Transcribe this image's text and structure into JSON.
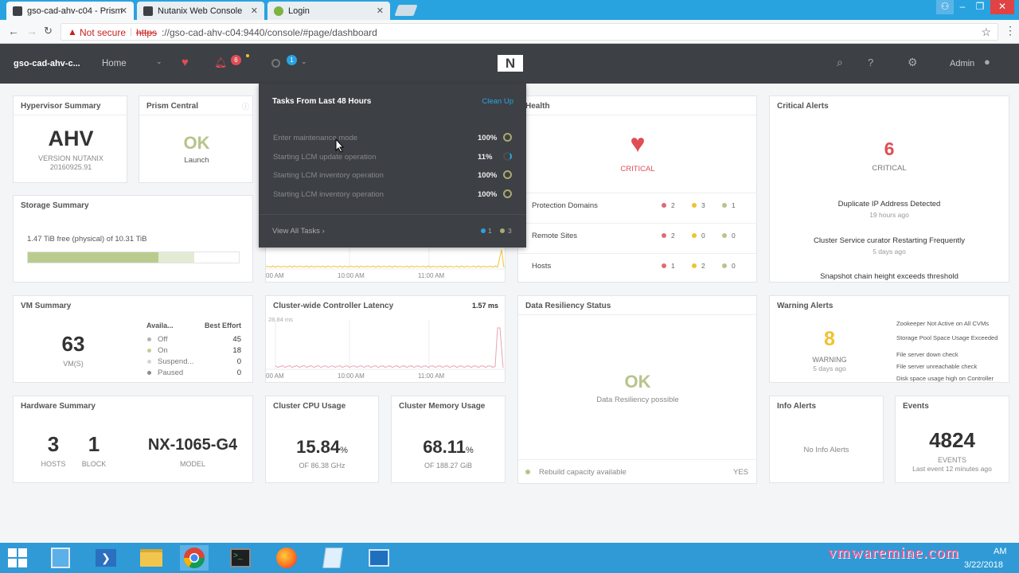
{
  "browser": {
    "tabs": [
      {
        "title": "gso-cad-ahv-c04 - Prism"
      },
      {
        "title": "Nutanix Web Console"
      },
      {
        "title": "Login"
      }
    ],
    "security": "Not secure",
    "url_scheme": "https",
    "url_rest": "://gso-cad-ahv-c04:9440/console/#page/dashboard"
  },
  "nav": {
    "cluster": "gso-cad-ahv-c...",
    "home": "Home",
    "alerts_count": "6",
    "tasks_count": "1",
    "user": "Admin"
  },
  "tasks_dropdown": {
    "title": "Tasks From Last 48 Hours",
    "clean_up": "Clean Up",
    "tasks": [
      {
        "name": "Enter maintenance mode",
        "pct": "100%"
      },
      {
        "name": "Starting LCM update operation",
        "pct": "11%"
      },
      {
        "name": "Starting LCM inventory operation",
        "pct": "100%"
      },
      {
        "name": "Starting LCM inventory operation",
        "pct": "100%"
      }
    ],
    "view_all": "View All Tasks",
    "running": "1",
    "done": "3"
  },
  "hypervisor": {
    "title": "Hypervisor Summary",
    "name": "AHV",
    "version_line1": "VERSION NUTANIX",
    "version_line2": "20160925.91"
  },
  "prism_central": {
    "title": "Prism Central",
    "status": "OK",
    "link": "Launch"
  },
  "storage": {
    "title": "Storage Summary",
    "text": "1.47 TiB free (physical) of 10.31 TiB",
    "used_fraction": 0.62,
    "reserved_fraction": 0.17
  },
  "health": {
    "title": "Health",
    "status": "CRITICAL",
    "rows": [
      {
        "label": "Protection Domains",
        "red": "2",
        "yellow": "3",
        "green": "1"
      },
      {
        "label": "Remote Sites",
        "red": "2",
        "yellow": "0",
        "green": "0"
      },
      {
        "label": "Hosts",
        "red": "1",
        "yellow": "2",
        "green": "0"
      }
    ]
  },
  "critical_alerts": {
    "title": "Critical Alerts",
    "count": "6",
    "label": "CRITICAL",
    "items": [
      {
        "text": "Duplicate IP Address Detected",
        "time": "19 hours ago"
      },
      {
        "text": "Cluster Service curator Restarting Frequently",
        "time": "5 days ago"
      },
      {
        "text": "Snapshot chain height exceeds threshold",
        "time": ""
      }
    ]
  },
  "iops_chart": {
    "ticks": [
      "00 AM",
      "10:00 AM",
      "11:00 AM"
    ]
  },
  "vm": {
    "title": "VM Summary",
    "count": "63",
    "label": "VM(S)",
    "col1": "Availa...",
    "col2": "Best Effort",
    "rows": [
      {
        "label": "Off",
        "value": "45"
      },
      {
        "label": "On",
        "value": "18"
      },
      {
        "label": "Suspend...",
        "value": "0"
      },
      {
        "label": "Paused",
        "value": "0"
      }
    ]
  },
  "latency": {
    "title": "Cluster-wide Controller Latency",
    "value": "1.57 ms",
    "max": "28.84 ms",
    "ticks": [
      "00 AM",
      "10:00 AM",
      "11:00 AM"
    ]
  },
  "resiliency": {
    "title": "Data Resiliency Status",
    "status": "OK",
    "sub": "Data Resiliency possible",
    "rebuild": "Rebuild capacity available",
    "rebuild_val": "YES"
  },
  "warning": {
    "title": "Warning Alerts",
    "count": "8",
    "label": "WARNING",
    "time": "5 days ago",
    "items": [
      "Zookeeper Not Active on All CVMs",
      "Storage Pool Space Usage Exceeded",
      "File server down check",
      "File server unreachable check",
      "Disk space usage high on Controller"
    ]
  },
  "hardware": {
    "title": "Hardware Summary",
    "hosts": "3",
    "hosts_label": "HOSTS",
    "blocks": "1",
    "blocks_label": "BLOCK",
    "model": "NX-1065-G4",
    "model_label": "MODEL"
  },
  "cpu": {
    "title": "Cluster CPU Usage",
    "value": "15.84",
    "unit": "%",
    "sub": "OF 86.38 GHz"
  },
  "memory": {
    "title": "Cluster Memory Usage",
    "value": "68.11",
    "unit": "%",
    "sub": "OF 188.27 GiB"
  },
  "info": {
    "title": "Info Alerts",
    "text": "No Info Alerts"
  },
  "events": {
    "title": "Events",
    "count": "4824",
    "label": "EVENTS",
    "sub": "Last event 12 minutes ago"
  },
  "taskbar": {
    "time": "AM",
    "date": "3/22/2018",
    "watermark": "vmwaremine.com"
  },
  "colors": {
    "critical": "#e04d55",
    "warning": "#f0c22e",
    "ok": "#b7c48b",
    "nav": "#3d4045"
  }
}
